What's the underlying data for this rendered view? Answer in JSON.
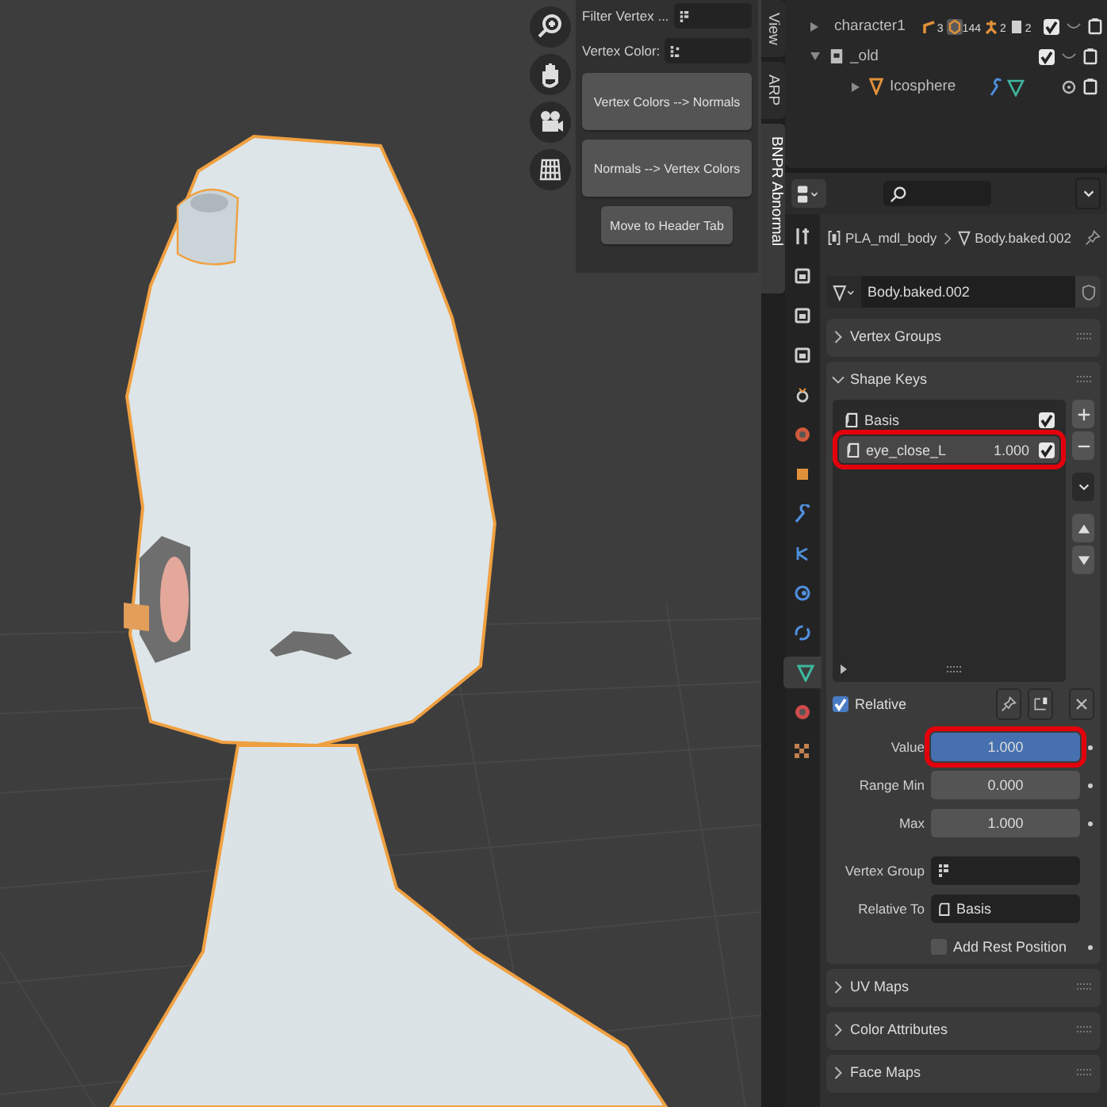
{
  "viewport": {
    "sidebar": {
      "filter_label": "Filter Vertex ...",
      "vertex_color_label": "Vertex Color:",
      "buttons": [
        "Vertex Colors --> Normals",
        "Normals --> Vertex Colors",
        "Move to Header Tab"
      ]
    },
    "sidebar_tabs": [
      {
        "label": "View",
        "selected": false
      },
      {
        "label": "ARP",
        "selected": false
      },
      {
        "label": "BNPR Abnormal",
        "selected": true
      }
    ]
  },
  "outliner": {
    "items": [
      {
        "name": "character1",
        "kind": "collection",
        "expanded": false,
        "checked": true,
        "counts": [
          {
            "kind": "bone",
            "count": "3"
          },
          {
            "kind": "mesh",
            "count": "144"
          },
          {
            "kind": "pose",
            "count": "2"
          },
          {
            "kind": "collection",
            "count": "2"
          }
        ]
      },
      {
        "name": "_old",
        "kind": "collection",
        "expanded": true,
        "checked": true,
        "children": [
          {
            "name": "Icosphere",
            "kind": "object",
            "expanded": false
          }
        ]
      }
    ]
  },
  "properties": {
    "tabs": [
      {
        "kind": "tool",
        "selected": false
      },
      {
        "kind": "render",
        "selected": false
      },
      {
        "kind": "output",
        "selected": false
      },
      {
        "kind": "view_layer",
        "selected": false
      },
      {
        "kind": "scene",
        "selected": false
      },
      {
        "kind": "world",
        "selected": false
      },
      {
        "kind": "object",
        "selected": false
      },
      {
        "kind": "modifier",
        "selected": false
      },
      {
        "kind": "particles",
        "selected": false
      },
      {
        "kind": "physics",
        "selected": false
      },
      {
        "kind": "constraints",
        "selected": false
      },
      {
        "kind": "data",
        "selected": true
      },
      {
        "kind": "material",
        "selected": false
      },
      {
        "kind": "texture",
        "selected": false
      }
    ],
    "breadcrumb": [
      "PLA_mdl_body",
      "Body.baked.002"
    ],
    "data_block": "Body.baked.002",
    "panels": [
      {
        "title": "Vertex Groups",
        "expanded": false
      },
      {
        "title": "Shape Keys",
        "expanded": true,
        "shape_keys": {
          "items": [
            {
              "name": "Basis",
              "checked": true,
              "selected": false,
              "highlighted": false
            },
            {
              "name": "eye_close_L",
              "value": "1.000",
              "checked": true,
              "selected": true,
              "highlighted": true
            }
          ],
          "relative": {
            "label": "Relative",
            "checked": true
          },
          "fields": [
            {
              "kind": "slider",
              "label": "Value",
              "value": "1.000",
              "level": 1,
              "highlighted": true
            },
            {
              "kind": "number",
              "label": "Range Min",
              "value": "0.000",
              "highlighted": false
            },
            {
              "kind": "number",
              "label": "Max",
              "value": "1.000",
              "highlighted": false
            },
            {
              "kind": "group",
              "label": "Vertex Group",
              "highlighted": false
            },
            {
              "kind": "key",
              "label": "Relative To",
              "value": "Basis",
              "highlighted": false
            }
          ],
          "add_rest_position": {
            "label": "Add Rest Position",
            "checked": false
          }
        }
      },
      {
        "title": "UV Maps",
        "expanded": false
      },
      {
        "title": "Color Attributes",
        "expanded": false
      },
      {
        "title": "Face Maps",
        "expanded": false
      }
    ]
  }
}
